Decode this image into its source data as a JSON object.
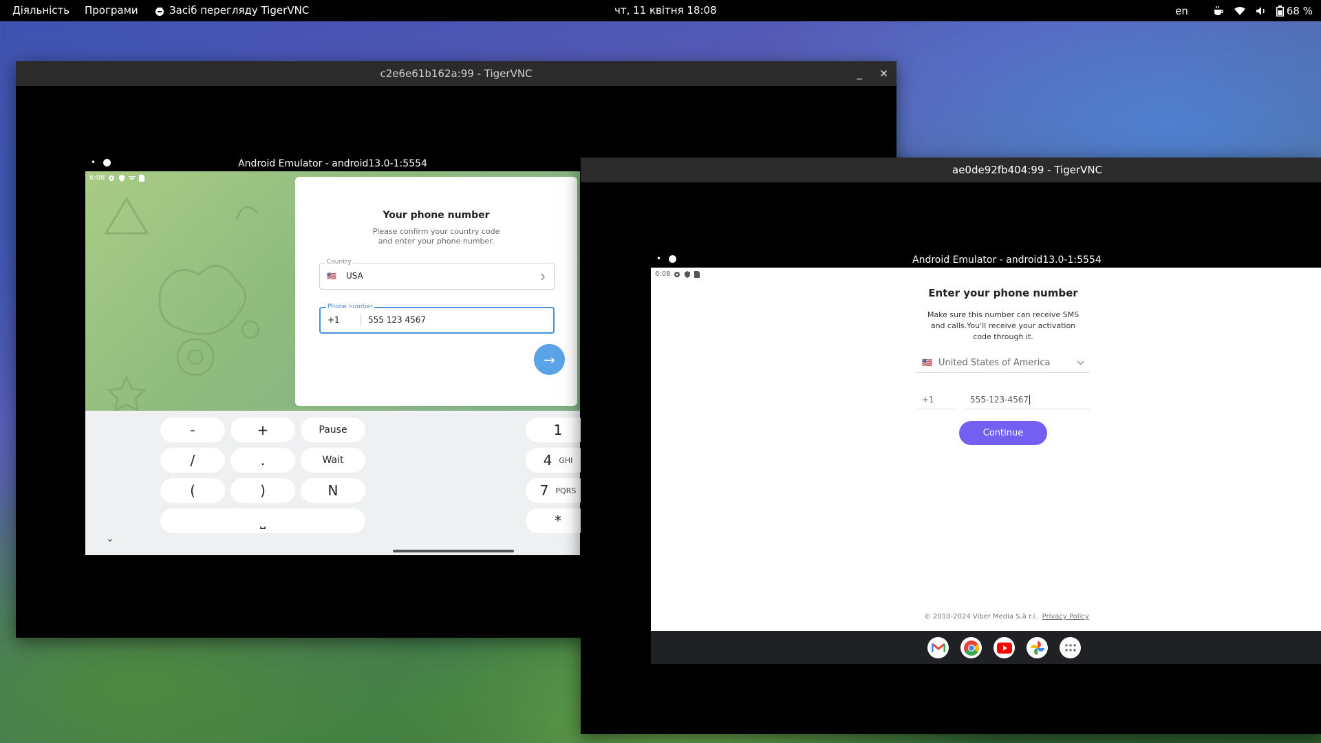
{
  "topbar": {
    "activities": "Діяльність",
    "apps": "Програми",
    "app_name": "Засіб перегляду TigerVNC",
    "datetime": "чт, 11 квітня  18:08",
    "lang": "en",
    "battery": "68 %"
  },
  "vnc1": {
    "title": "c2e6e61b162a:99 - TigerVNC",
    "min": "_",
    "close": "✕"
  },
  "emu1": {
    "title": "Android Emulator - android13.0-1:5554",
    "time": "6:08"
  },
  "telegram": {
    "heading": "Your phone number",
    "subtitle_line1": "Please confirm your country code",
    "subtitle_line2": "and enter your phone number.",
    "country_label": "Country",
    "country_flag": "🇺🇸",
    "country_value": "USA",
    "phone_label": "Phone number",
    "phone_code": "+1",
    "phone_value": "555 123 4567",
    "next_arrow": "→"
  },
  "keypad": {
    "minus": "-",
    "plus": "+",
    "pause": "Pause",
    "slash": "/",
    "dot": ".",
    "wait": "Wait",
    "lparen": "(",
    "rparen": ")",
    "n": "N",
    "space": "⎵",
    "k1": "1",
    "k4": "4",
    "k4_sub": "GHI",
    "k7": "7",
    "k7_sub": "PQRS",
    "star": "*",
    "collapse": "⌄"
  },
  "vnc2": {
    "title": "ae0de92fb404:99 - TigerVNC"
  },
  "emu2": {
    "title": "Android Emulator - android13.0-1:5554",
    "time": "6:08"
  },
  "viber": {
    "heading": "Enter your phone number",
    "desc_line1": "Make sure this number can receive SMS",
    "desc_line2": "and calls.You'll receive your activation",
    "desc_line3": "code through it.",
    "country_flag": "🇺🇸",
    "country": "United States of America",
    "code": "+1",
    "phone": "555-123-4567",
    "continue": "Continue",
    "footer": "© 2010-2024 Viber Media S.à r.l.",
    "privacy": "Privacy Policy",
    "accent": "#7360f2"
  }
}
